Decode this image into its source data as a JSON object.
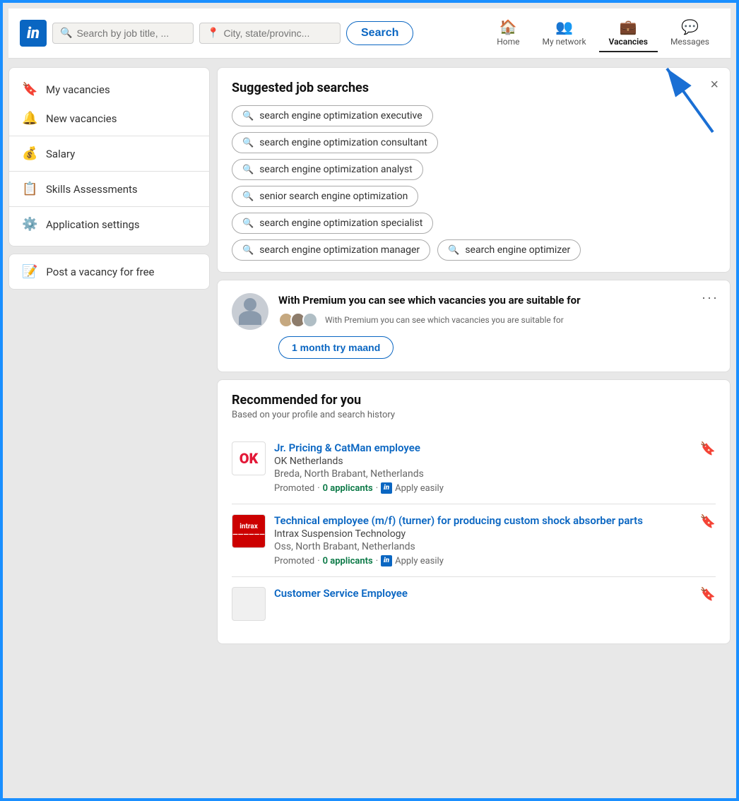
{
  "header": {
    "logo": "in",
    "search_placeholder": "Search by job title, ...",
    "location_placeholder": "City, state/provinc...",
    "search_button": "Search",
    "nav": [
      {
        "id": "home",
        "label": "Home",
        "icon": "🏠"
      },
      {
        "id": "network",
        "label": "My network",
        "icon": "👥"
      },
      {
        "id": "vacancies",
        "label": "Vacancies",
        "icon": "💼",
        "active": true
      },
      {
        "id": "messages",
        "label": "Messages",
        "icon": "💬"
      }
    ]
  },
  "sidebar": {
    "menu_items": [
      {
        "id": "my-vacancies",
        "label": "My vacancies",
        "icon": "🔖"
      },
      {
        "id": "new-vacancies",
        "label": "New vacancies",
        "icon": "🔔"
      },
      {
        "id": "salary",
        "label": "Salary",
        "icon": "💰"
      },
      {
        "id": "skills",
        "label": "Skills Assessments",
        "icon": "📋"
      },
      {
        "id": "app-settings",
        "label": "Application settings",
        "icon": "⚙️"
      }
    ],
    "post_vacancy": "Post a vacancy for free"
  },
  "suggested": {
    "title": "Suggested job searches",
    "close_label": "×",
    "chips": [
      "search engine optimization executive",
      "search engine optimization consultant",
      "search engine optimization analyst",
      "senior search engine optimization",
      "search engine optimization specialist",
      "search engine optimization manager",
      "search engine optimizer"
    ]
  },
  "premium": {
    "title": "With Premium you can see which vacancies you are suitable for",
    "sub_text": "With Premium you can see which vacancies you are suitable for",
    "button": "1 month try maand",
    "more_icon": "•••"
  },
  "recommended": {
    "title": "Recommended for you",
    "sub": "Based on your profile and search history",
    "jobs": [
      {
        "id": "job1",
        "title": "Jr. Pricing & CatMan employee",
        "company": "OK Netherlands",
        "location": "Breda, North Brabant, Netherlands",
        "meta_prefix": "Promoted",
        "applicants": "0 applicants",
        "apply": "Apply easily",
        "logo_type": "ok"
      },
      {
        "id": "job2",
        "title": "Technical employee (m/f) (turner) for producing custom shock absorber parts",
        "company": "Intrax Suspension Technology",
        "location": "Oss, North Brabant, Netherlands",
        "meta_prefix": "Promoted",
        "applicants": "0 applicants",
        "apply": "Apply easily",
        "logo_type": "intrax"
      },
      {
        "id": "job3",
        "title": "Customer Service Employee",
        "company": "",
        "location": "",
        "meta_prefix": "",
        "applicants": "",
        "apply": "",
        "logo_type": "none"
      }
    ]
  }
}
